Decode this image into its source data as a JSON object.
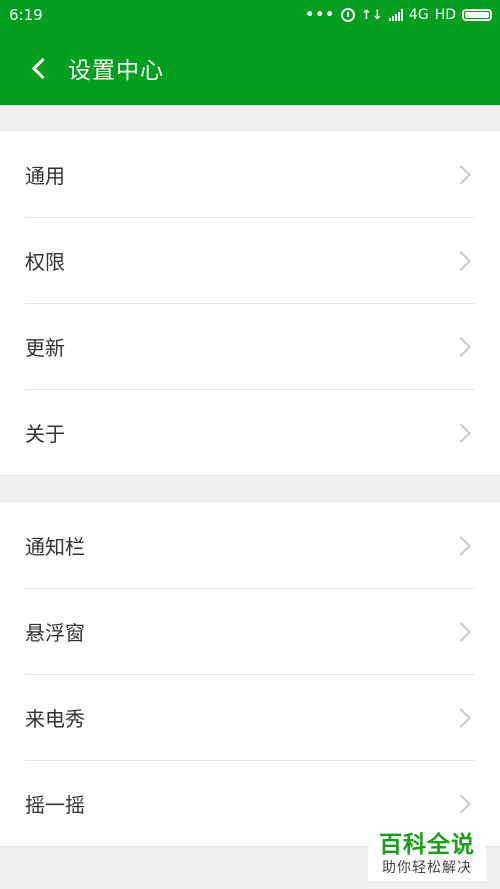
{
  "status_bar": {
    "time": "6:19",
    "dots": "•••",
    "network": "4G",
    "hd": "HD",
    "data_arrows": "↑↓"
  },
  "header": {
    "title": "设置中心",
    "accent_color": "#00a01e"
  },
  "groups": [
    {
      "items": [
        {
          "label": "通用"
        },
        {
          "label": "权限"
        },
        {
          "label": "更新"
        },
        {
          "label": "关于"
        }
      ]
    },
    {
      "items": [
        {
          "label": "通知栏"
        },
        {
          "label": "悬浮窗"
        },
        {
          "label": "来电秀"
        },
        {
          "label": "摇一摇"
        }
      ]
    }
  ],
  "watermark": {
    "main": "百科全说",
    "sub": "助你轻松解决"
  },
  "icons": {
    "back": "back-arrow-icon",
    "row_arrow": "chevron-right-icon",
    "alarm": "alarm-icon",
    "signal": "signal-icon",
    "battery": "battery-icon"
  }
}
